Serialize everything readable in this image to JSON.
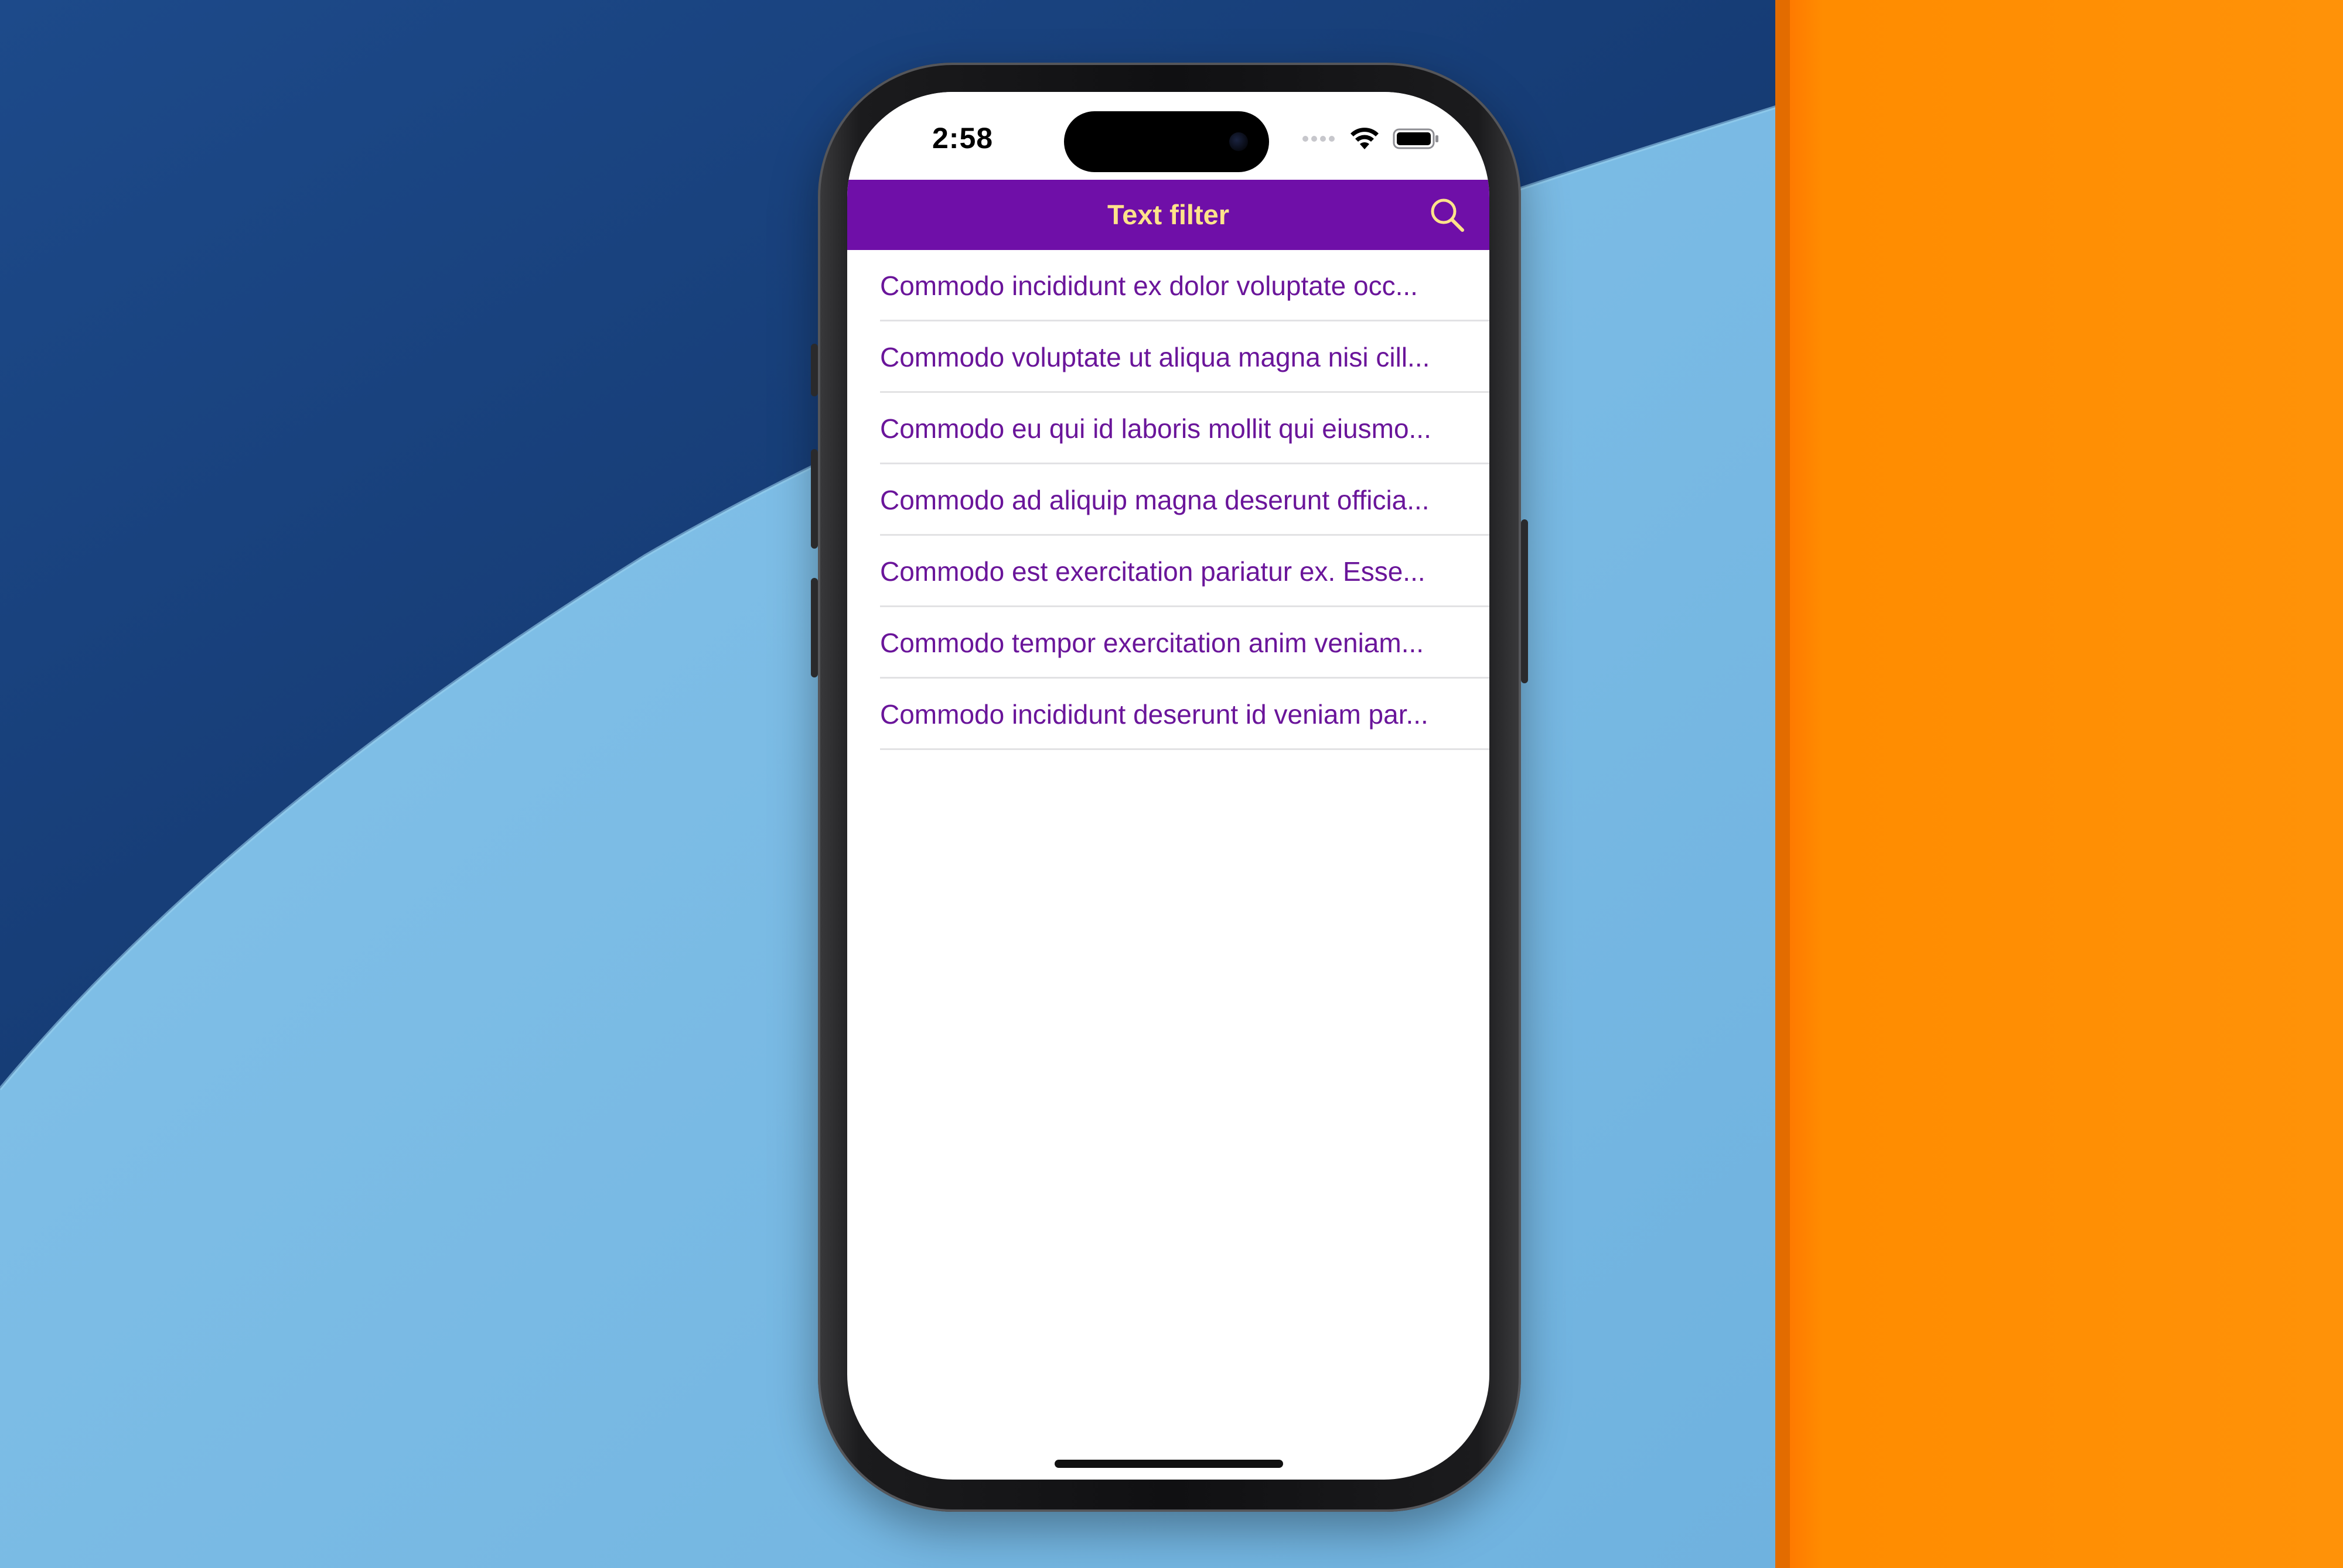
{
  "status_bar": {
    "time": "2:58"
  },
  "nav": {
    "title": "Text filter",
    "search_icon": "search-icon"
  },
  "list": {
    "items": [
      {
        "label": "Commodo incididunt ex dolor voluptate occ..."
      },
      {
        "label": "Commodo voluptate ut aliqua magna nisi cill..."
      },
      {
        "label": "Commodo eu qui id laboris mollit qui eiusmo..."
      },
      {
        "label": "Commodo ad aliquip magna deserunt officia..."
      },
      {
        "label": "Commodo est exercitation pariatur ex. Esse..."
      },
      {
        "label": "Commodo tempor exercitation anim veniam..."
      },
      {
        "label": "Commodo incididunt deserunt id veniam par..."
      }
    ]
  },
  "colors": {
    "nav_background": "#6f0fa8",
    "nav_title": "#ffe38a",
    "list_text": "#6a159a",
    "backdrop_dark_blue": "#163a72",
    "backdrop_light_blue": "#7dbde6",
    "backdrop_orange": "#ff8f00"
  }
}
